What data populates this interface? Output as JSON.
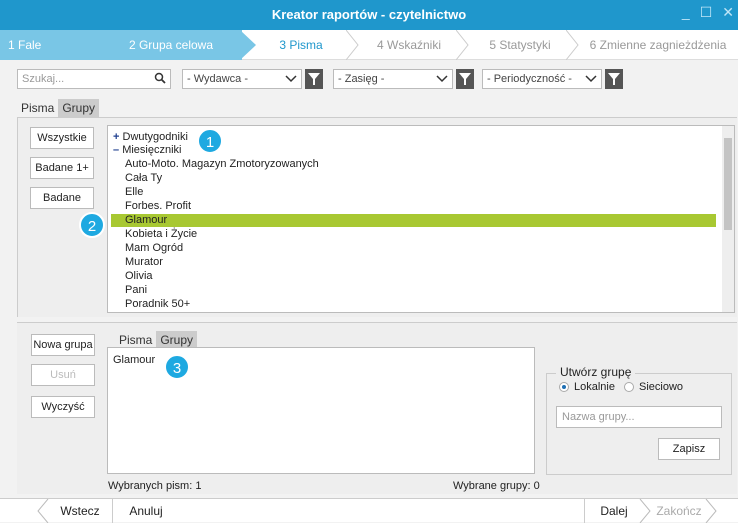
{
  "window": {
    "title": "Kreator raportów - czytelnictwo"
  },
  "steps": [
    "1  Fale",
    "2  Grupa celowa",
    "3  Pisma",
    "4  Wskaźniki",
    "5  Statystyki",
    "6  Zmienne zagnieżdżenia"
  ],
  "filters": {
    "search_placeholder": "Szukaj...",
    "publisher": "- Wydawca -",
    "range": "- Zasięg -",
    "frequency": "- Periodyczność -"
  },
  "top_tabs": [
    "Pisma",
    "Grupy"
  ],
  "side_buttons": {
    "all": "Wszystkie",
    "studied1": "Badane 1+",
    "studied": "Badane"
  },
  "list": {
    "group1": "Dwutygodniki",
    "group2": "Miesięczniki",
    "items": [
      "Auto-Moto. Magazyn Zmotoryzowanych",
      "Cała Ty",
      "Elle",
      "Forbes. Profit",
      "Glamour",
      "Kobieta i Życie",
      "Mam Ogród",
      "Murator",
      "Olivia",
      "Pani",
      "Poradnik 50+"
    ],
    "selected": "Glamour"
  },
  "badges": [
    "1",
    "2",
    "3"
  ],
  "bottom_buttons": {
    "new_group": "Nowa grupa",
    "remove": "Usuń",
    "clear": "Wyczyść"
  },
  "bottom_tabs": [
    "Pisma",
    "Grupy"
  ],
  "selected_items": [
    "Glamour"
  ],
  "create_group": {
    "legend": "Utwórz grupę",
    "local": "Lokalnie",
    "network": "Sieciowo",
    "name_placeholder": "Nazwa grupy...",
    "save": "Zapisz"
  },
  "status": {
    "selected_magazines": "Wybranych pism: 1",
    "selected_groups": "Wybrane grupy: 0"
  },
  "footer": {
    "back": "Wstecz",
    "cancel": "Anuluj",
    "next": "Dalej",
    "finish": "Zakończ"
  }
}
